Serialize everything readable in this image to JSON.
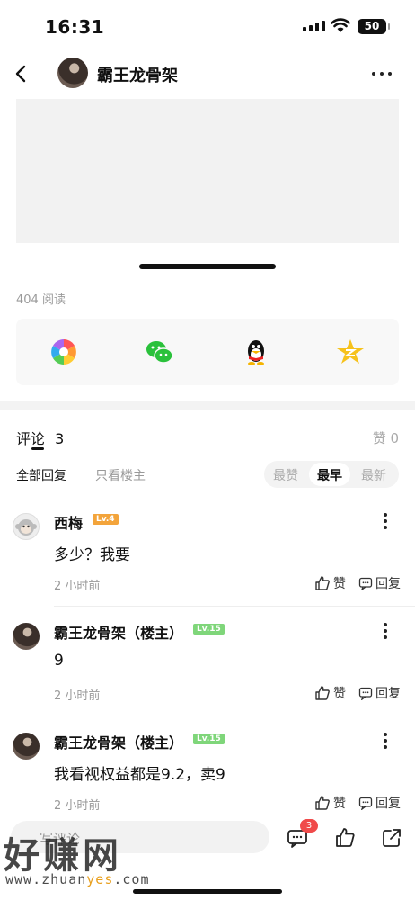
{
  "status": {
    "time": "16:31",
    "battery": "50"
  },
  "nav": {
    "title": "霸王龙骨架"
  },
  "post": {
    "read_count": "404 阅读"
  },
  "comments": {
    "label": "评论",
    "count": "3",
    "likes": "赞 0",
    "filter_all": "全部回复",
    "filter_host": "只看楼主",
    "sort": [
      "最赞",
      "最早",
      "最新"
    ],
    "sort_selected": "最早",
    "items": [
      {
        "name": "西梅",
        "level": "Lv.4",
        "text": "多少？我要",
        "time": "2 小时前"
      },
      {
        "name": "霸王龙骨架（楼主）",
        "level": "Lv.15",
        "text": "9",
        "time": "2 小时前"
      },
      {
        "name": "霸王龙骨架（楼主）",
        "level": "Lv.15",
        "text": "我看视权益都是9.2，卖9",
        "time": "2 小时前"
      }
    ],
    "like_label": "赞",
    "reply_label": "回复"
  },
  "bottom": {
    "input_placeholder": "写评论",
    "comment_badge": "3"
  },
  "watermark": {
    "brand": "好赚网",
    "url_pre": "www.zhuan",
    "url_hl": "yes",
    "url_post": ".com"
  },
  "colors": {
    "lv_orange": "#f3a43b",
    "lv_green": "#7fd67a",
    "badge": "#f04a4a"
  }
}
